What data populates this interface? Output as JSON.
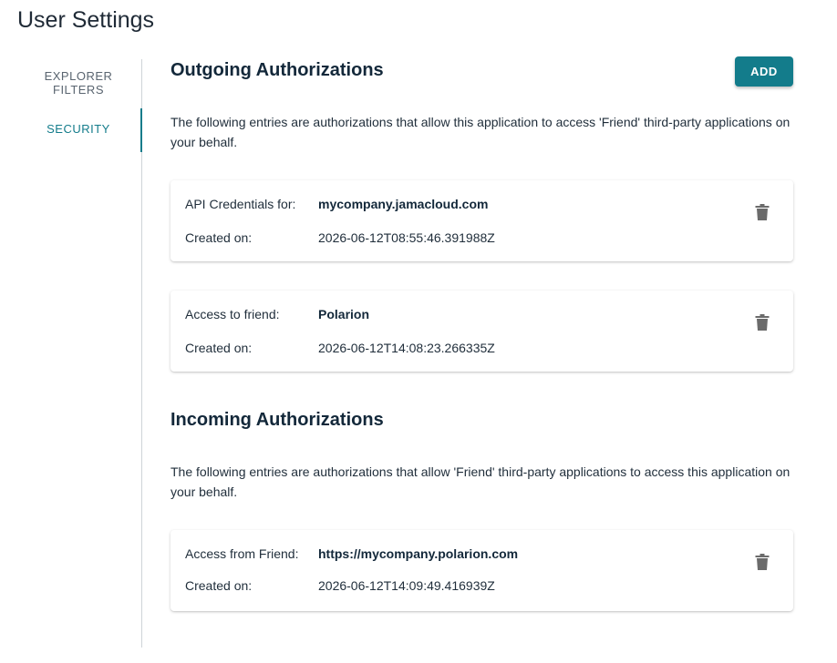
{
  "page": {
    "title": "User Settings"
  },
  "tabs": [
    {
      "label": "EXPLORER FILTERS"
    },
    {
      "label": "SECURITY"
    }
  ],
  "outgoing": {
    "title": "Outgoing Authorizations",
    "add_label": "ADD",
    "description": "The following entries are authorizations that allow this application to access 'Friend' third-party applications on your behalf.",
    "entries": [
      {
        "label": "API Credentials for:",
        "value": "mycompany.jamacloud.com",
        "created_label": "Created on:",
        "created_value": "2026-06-12T08:55:46.391988Z"
      },
      {
        "label": "Access to friend:",
        "value": "Polarion",
        "created_label": "Created on:",
        "created_value": "2026-06-12T14:08:23.266335Z"
      }
    ]
  },
  "incoming": {
    "title": "Incoming Authorizations",
    "description": "The following entries are authorizations that allow 'Friend' third-party applications to access this application on your behalf.",
    "entries": [
      {
        "label": "Access from Friend:",
        "value": "https://mycompany.polarion.com",
        "created_label": "Created on:",
        "created_value": "2026-06-12T14:09:49.416939Z"
      }
    ]
  },
  "icons": {
    "delete": "trash-icon"
  },
  "colors": {
    "accent": "#137c8b",
    "icon": "#6b6b6b",
    "heading": "#13283a"
  }
}
